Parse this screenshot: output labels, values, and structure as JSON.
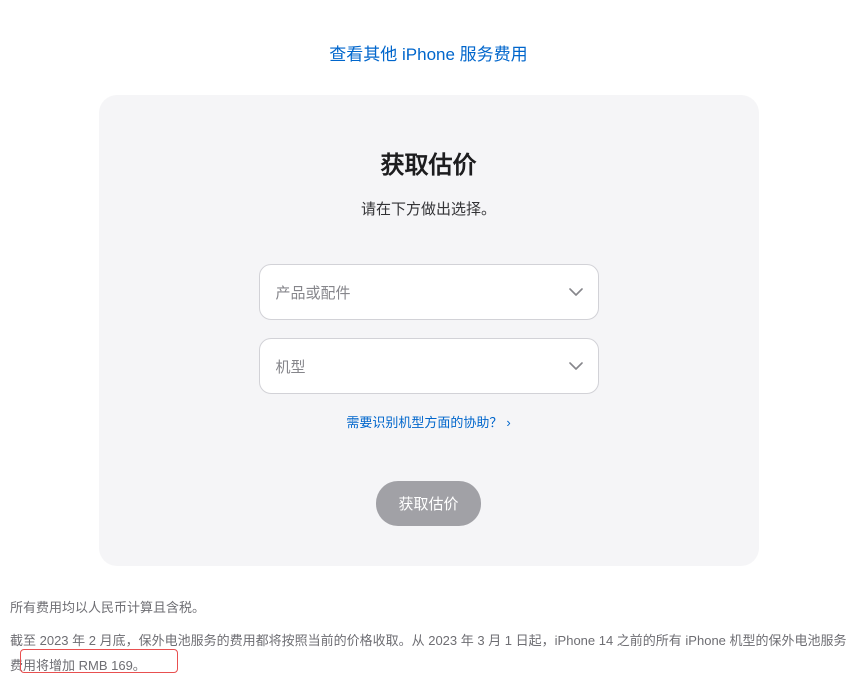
{
  "top_link": "查看其他 iPhone 服务费用",
  "card": {
    "title": "获取估价",
    "subtitle": "请在下方做出选择。",
    "select_product_placeholder": "产品或配件",
    "select_model_placeholder": "机型",
    "help_text": "需要识别机型方面的协助？",
    "submit_label": "获取估价"
  },
  "footnote": "所有费用均以人民币计算且含税。",
  "disclaimer": "截至 2023 年 2 月底，保外电池服务的费用都将按照当前的价格收取。从 2023 年 3 月 1 日起，iPhone 14 之前的所有 iPhone 机型的保外电池服务费用将增加 RMB 169。"
}
